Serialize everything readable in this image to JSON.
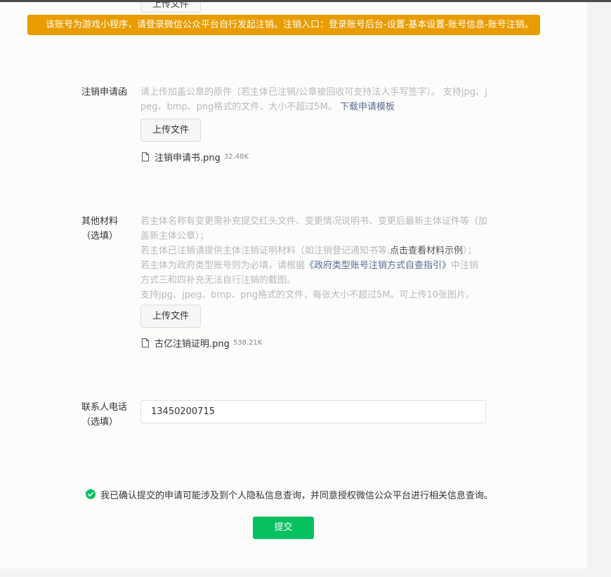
{
  "warning": "该账号为游戏小程序，请登录微信公众平台自行发起注销。注销入口：登录账号后台-设置-基本设置-账号信息-账号注销。",
  "upload_label": "上传文件",
  "application_letter": {
    "label": "注销申请函",
    "help_text": "请上传加盖公章的原件（若主体已注销/公章被回收可支持法人手写签字）。 支持jpg、jpeg、bmp、png格式的文件，大小不超过5M。 ",
    "template_link": "下载申请模板",
    "file": {
      "name": "注销申请书.png",
      "size": "32.48K"
    }
  },
  "other_materials": {
    "label": "其他材料（选填）",
    "line1": "若主体名称有变更需补充提交红头文件、变更情况说明书、变更后最新主体证件等（加盖新主体公章）；",
    "line2_prefix": "若主体已注销请提供主体注销证明材料（如注销登记通知书等,",
    "line2_link": "点击查看材料示例",
    "line2_suffix": "）；",
    "line3_prefix": "若主体为政府类型账号则为必填，请根据",
    "line3_link": "《政府类型账号注销方式自查指引》",
    "line3_suffix": "中注销方式三和四补充无法自行注销的截图。",
    "line4": "支持jpg、jpeg、bmp、png格式的文件，每张大小不超过5M。可上传10张图片。",
    "file": {
      "name": "古亿注销证明.png",
      "size": "538.21K"
    }
  },
  "contact_phone": {
    "label": "联系人电话（选填）",
    "value": "13450200715"
  },
  "consent": "我已确认提交的申请可能涉及到个人隐私信息查询，并同意授权微信公众平台进行相关信息查询。",
  "submit_label": "提交",
  "colors": {
    "warning_bg": "#e99c00",
    "primary": "#07c160",
    "link": "#576b95",
    "hint": "#b9b9b9"
  },
  "icons": [
    "file-icon",
    "check-circle-icon"
  ]
}
